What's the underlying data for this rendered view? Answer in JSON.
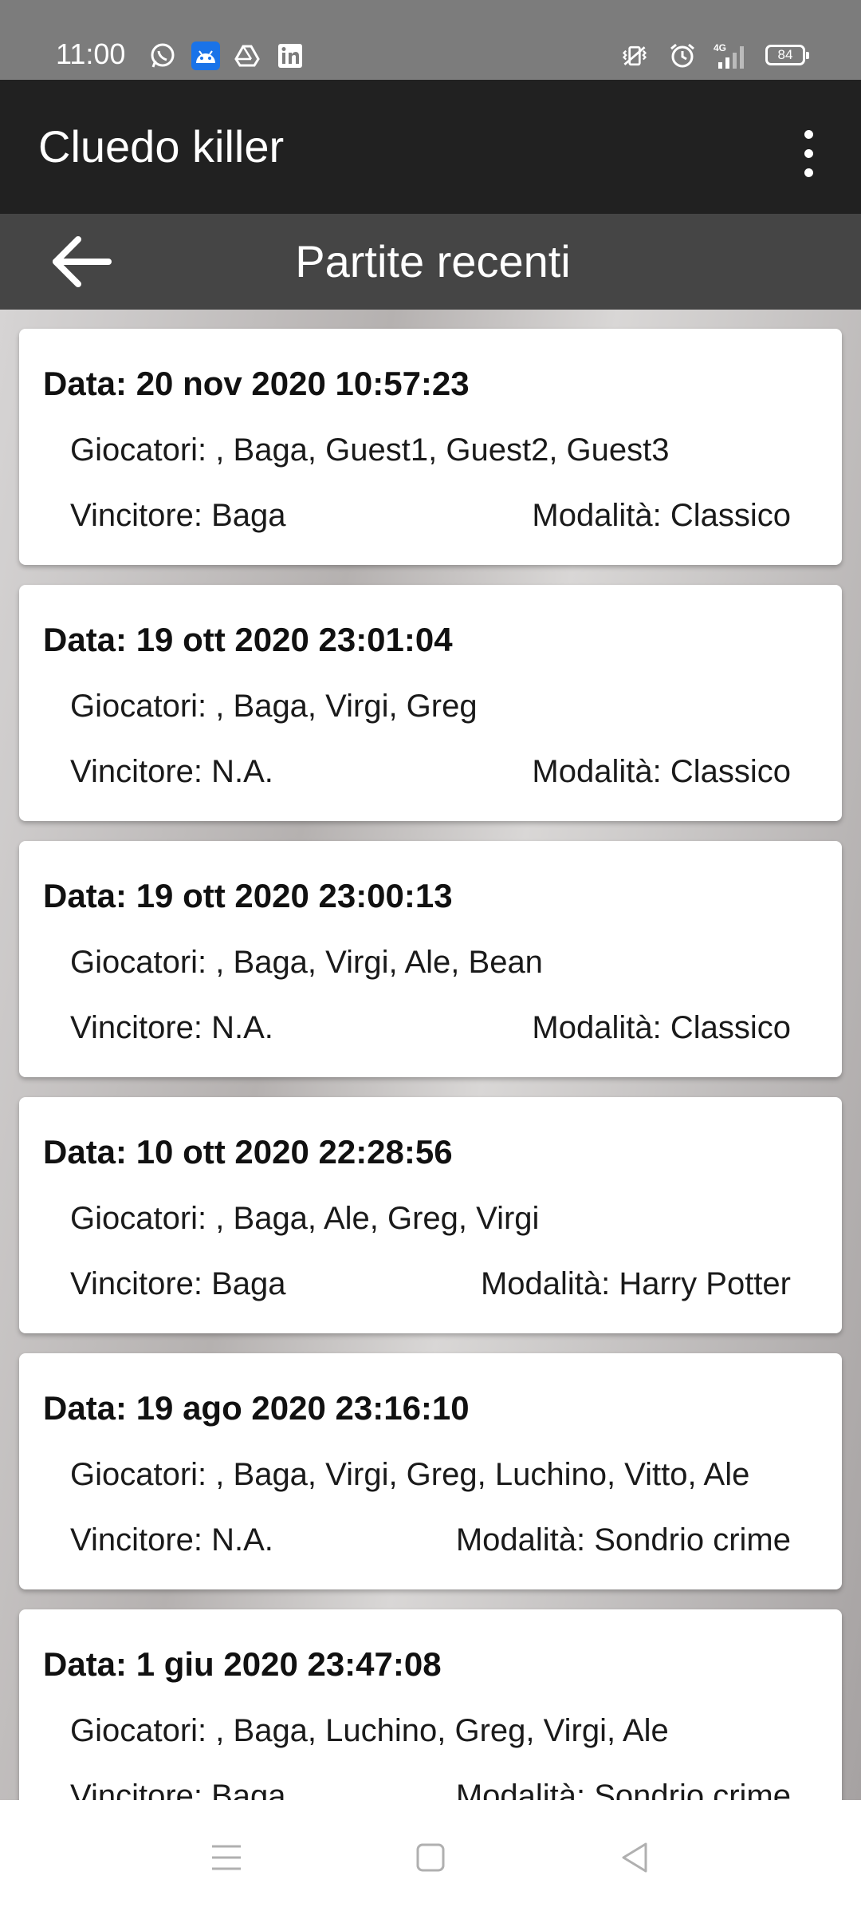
{
  "status_bar": {
    "time": "11:00",
    "left_icons": [
      "whatsapp-icon",
      "android-icon",
      "drive-icon",
      "linkedin-icon"
    ],
    "right_icons": [
      "vibrate-icon",
      "alarm-icon",
      "signal-4g-icon"
    ],
    "battery": "84"
  },
  "app_bar": {
    "title": "Cluedo killer",
    "menu_icon": "overflow-menu-icon"
  },
  "sub_header": {
    "back_icon": "back-arrow-icon",
    "title": "Partite recenti"
  },
  "games": [
    {
      "date": "Data: 20 nov 2020 10:57:23",
      "players": "Giocatori: , Baga, Guest1, Guest2, Guest3",
      "winner": "Vincitore: Baga",
      "mode": "Modalità: Classico"
    },
    {
      "date": "Data: 19 ott 2020 23:01:04",
      "players": "Giocatori: , Baga, Virgi, Greg",
      "winner": "Vincitore: N.A.",
      "mode": "Modalità: Classico"
    },
    {
      "date": "Data: 19 ott 2020 23:00:13",
      "players": "Giocatori: , Baga, Virgi, Ale, Bean",
      "winner": "Vincitore: N.A.",
      "mode": "Modalità: Classico"
    },
    {
      "date": "Data: 10 ott 2020 22:28:56",
      "players": "Giocatori: , Baga, Ale, Greg, Virgi",
      "winner": "Vincitore: Baga",
      "mode": "Modalità: Harry Potter"
    },
    {
      "date": "Data: 19 ago 2020 23:16:10",
      "players": "Giocatori: , Baga, Virgi, Greg, Luchino, Vitto, Ale",
      "winner": "Vincitore: N.A.",
      "mode": "Modalità: Sondrio crime"
    },
    {
      "date": "Data: 1 giu 2020 23:47:08",
      "players": "Giocatori: , Baga, Luchino, Greg, Virgi, Ale",
      "winner": "Vincitore: Baga",
      "mode": "Modalità: Sondrio crime"
    }
  ],
  "nav_bar": {
    "buttons": [
      "menu-icon",
      "home-icon",
      "back-icon"
    ]
  },
  "colors": {
    "status_bar": "#7c7c7c",
    "app_bar": "#212121",
    "sub_header": "#454545",
    "card": "#ffffff"
  }
}
